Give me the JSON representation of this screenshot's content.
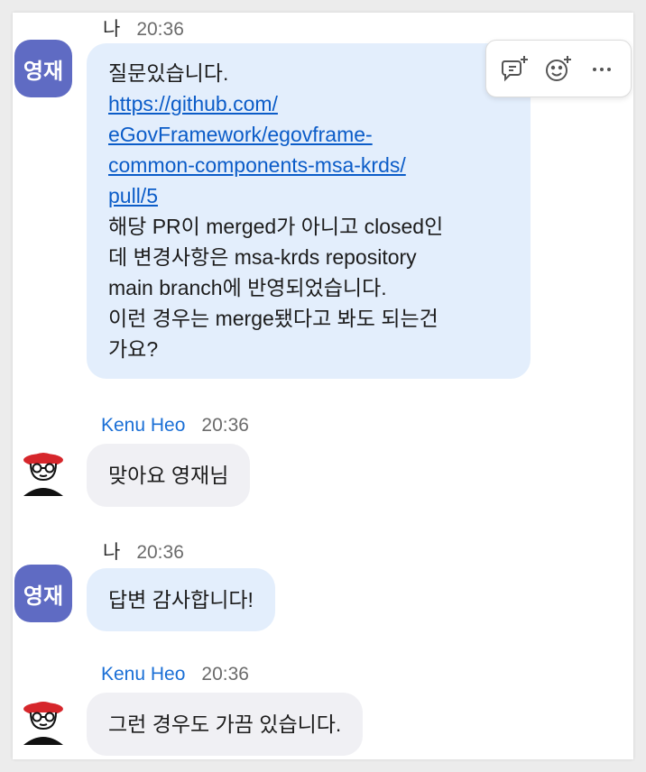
{
  "messages": [
    {
      "sender": "나",
      "time": "20:36",
      "avatar_label": "영재",
      "lines_before": [
        "질문있습니다."
      ],
      "link_lines": [
        "https://github.com/",
        "eGovFramework/egovframe-",
        "common-components-msa-krds/",
        "pull/5"
      ],
      "lines_after": [
        "해당 PR이 merged가 아니고 closed인",
        "데 변경사항은 msa-krds repository",
        "main branch에 반영되었습니다.",
        "이런 경우는 merge됐다고 봐도 되는건",
        "가요?"
      ]
    },
    {
      "sender": "Kenu Heo",
      "time": "20:36",
      "text": "맞아요 영재님"
    },
    {
      "sender": "나",
      "time": "20:36",
      "avatar_label": "영재",
      "text": "답변 감사합니다!"
    },
    {
      "sender": "Kenu Heo",
      "time": "20:36",
      "text": "그런 경우도 가끔 있습니다."
    }
  ],
  "toolbar": {
    "icons": [
      "reply-in-thread-icon",
      "add-reaction-icon",
      "more-actions-icon"
    ]
  },
  "colors": {
    "my_bubble": "#e3eefc",
    "other_bubble": "#f0f0f4",
    "avatar": "#5f6bc3",
    "link": "#0b5cc8",
    "other_name": "#1a6fd6"
  }
}
